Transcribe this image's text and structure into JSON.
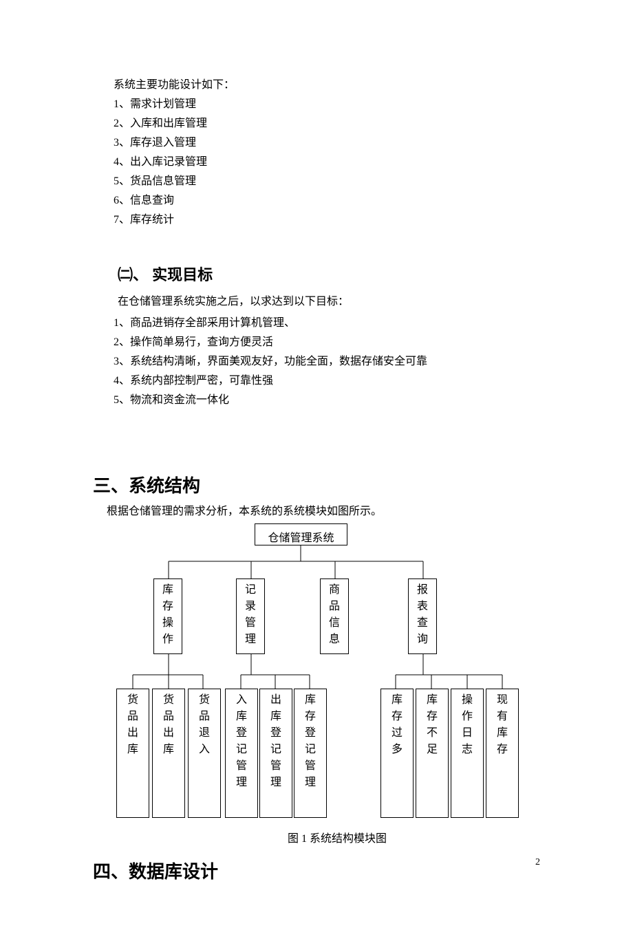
{
  "section_funcs": {
    "intro": "系统主要功能设计如下：",
    "items": [
      "1、需求计划管理",
      "2、入库和出库管理",
      "3、库存退入管理",
      "4、出入库记录管理",
      "5、货品信息管理",
      "6、信息查询",
      "7、库存统计"
    ]
  },
  "section_goal": {
    "heading": "㈡、 实现目标",
    "intro": "在仓储管理系统实施之后，以求达到以下目标：",
    "items": [
      "1、商品进销存全部采用计算机管理、",
      "2、操作简单易行，查询方便灵活",
      "3、系统结构清晰，界面美观友好，功能全面，数据存储安全可靠",
      "4、系统内部控制严密，可靠性强",
      "5、物流和资金流一体化"
    ]
  },
  "section_structure": {
    "heading": "三、系统结构",
    "intro": "根据仓储管理的需求分析，本系统的系统模块如图所示。",
    "caption": "图 1  系统结构模块图"
  },
  "diagram": {
    "root": "仓储管理系统",
    "level2": [
      "库存操作",
      "记录管理",
      "商品信息",
      "报表查询"
    ],
    "leaves_a": [
      "货品出库",
      "货品出库",
      "货品退入"
    ],
    "leaves_b": [
      "入库登记管理",
      "出库登记管理",
      "库存登记管理"
    ],
    "leaves_c": [
      "库存过多",
      "库存不足",
      "操作日志",
      "现有库存"
    ]
  },
  "section_db": {
    "heading": "四、数据库设计"
  },
  "page_number": "2"
}
